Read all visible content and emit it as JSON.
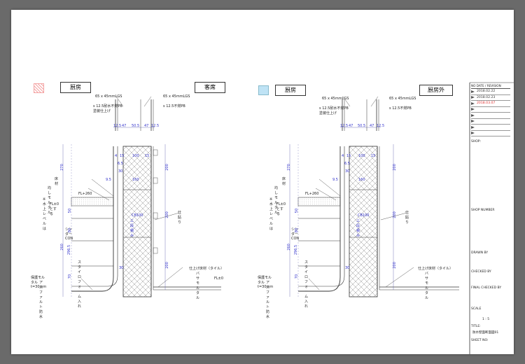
{
  "left_detail": {
    "room_left": "厨房",
    "room_right": "客席",
    "swatch_color": "#f4a4a4"
  },
  "right_detail": {
    "room_left": "厨房",
    "room_right": "厨房外",
    "swatch_color": "#bfe3f5"
  },
  "annotations": {
    "lgs_top": "65 x 45mmLGS",
    "lgs_side": "65 x 45mmLGS",
    "board_line1": "s 12.5耐水不燃PB",
    "board_line2": "塗装仕上げ",
    "board_right": "s 12.5不燃PB",
    "floor": "床材",
    "mortar": "均しモルタル",
    "fl_260": "FL+260",
    "water_level_1": "※水上レベルは",
    "water_level_2": "FL±0とする",
    "cinder": "シンダーCON",
    "styrofoam": "スタイロフォーム入れ",
    "protect": "保護モルタルt=30mm",
    "asphalt": "アスファルト防水",
    "cb": "CB100",
    "cb_stack": "三段積み",
    "tile_finish": "仕上げ床材（タイル）",
    "bed_mortar": "バサモルタル",
    "fl_0": "FL±0",
    "wallpaper": "仕貼り"
  },
  "dims": {
    "d12_5": "12.5",
    "d47": "47",
    "d50_5": "50.5",
    "d4": "4",
    "d15": "15",
    "d100": "100",
    "d160": "160",
    "d30": "30",
    "d9_5": "9.5",
    "d270": "270",
    "d200": "200",
    "d260": "260",
    "d296_5": "296.5",
    "d80": "80",
    "d20": "20",
    "d50": "50",
    "d70": "70",
    "d150": "150",
    "d6_5": "6.5"
  },
  "title_block": {
    "rev_header": "NO  DATE  /  REVISION",
    "revisions": [
      {
        "date": "2018.02.22",
        "color": "#333333"
      },
      {
        "date": "2018.02.23",
        "color": "#333333"
      },
      {
        "date": "2018.03.07",
        "color": "#e03030"
      },
      {
        "date": "",
        "color": "#333333"
      },
      {
        "date": "",
        "color": "#333333"
      },
      {
        "date": "",
        "color": "#333333"
      },
      {
        "date": "",
        "color": "#333333"
      },
      {
        "date": "",
        "color": "#333333"
      }
    ],
    "shop_label": "SHOP:",
    "shop_number_label": "SHOP NUMBER",
    "drawn_by_label": "DRAWN BY",
    "checked_by_label": "CHECKED BY",
    "final_checked_label": "FINAL CHECKED BY",
    "scale_label": "SCALE",
    "scale_value": "1 : 5",
    "title_label": "TITLE:",
    "title_value": "防水壁面断面図01",
    "sheet_no_label": "SHEET NO:"
  }
}
